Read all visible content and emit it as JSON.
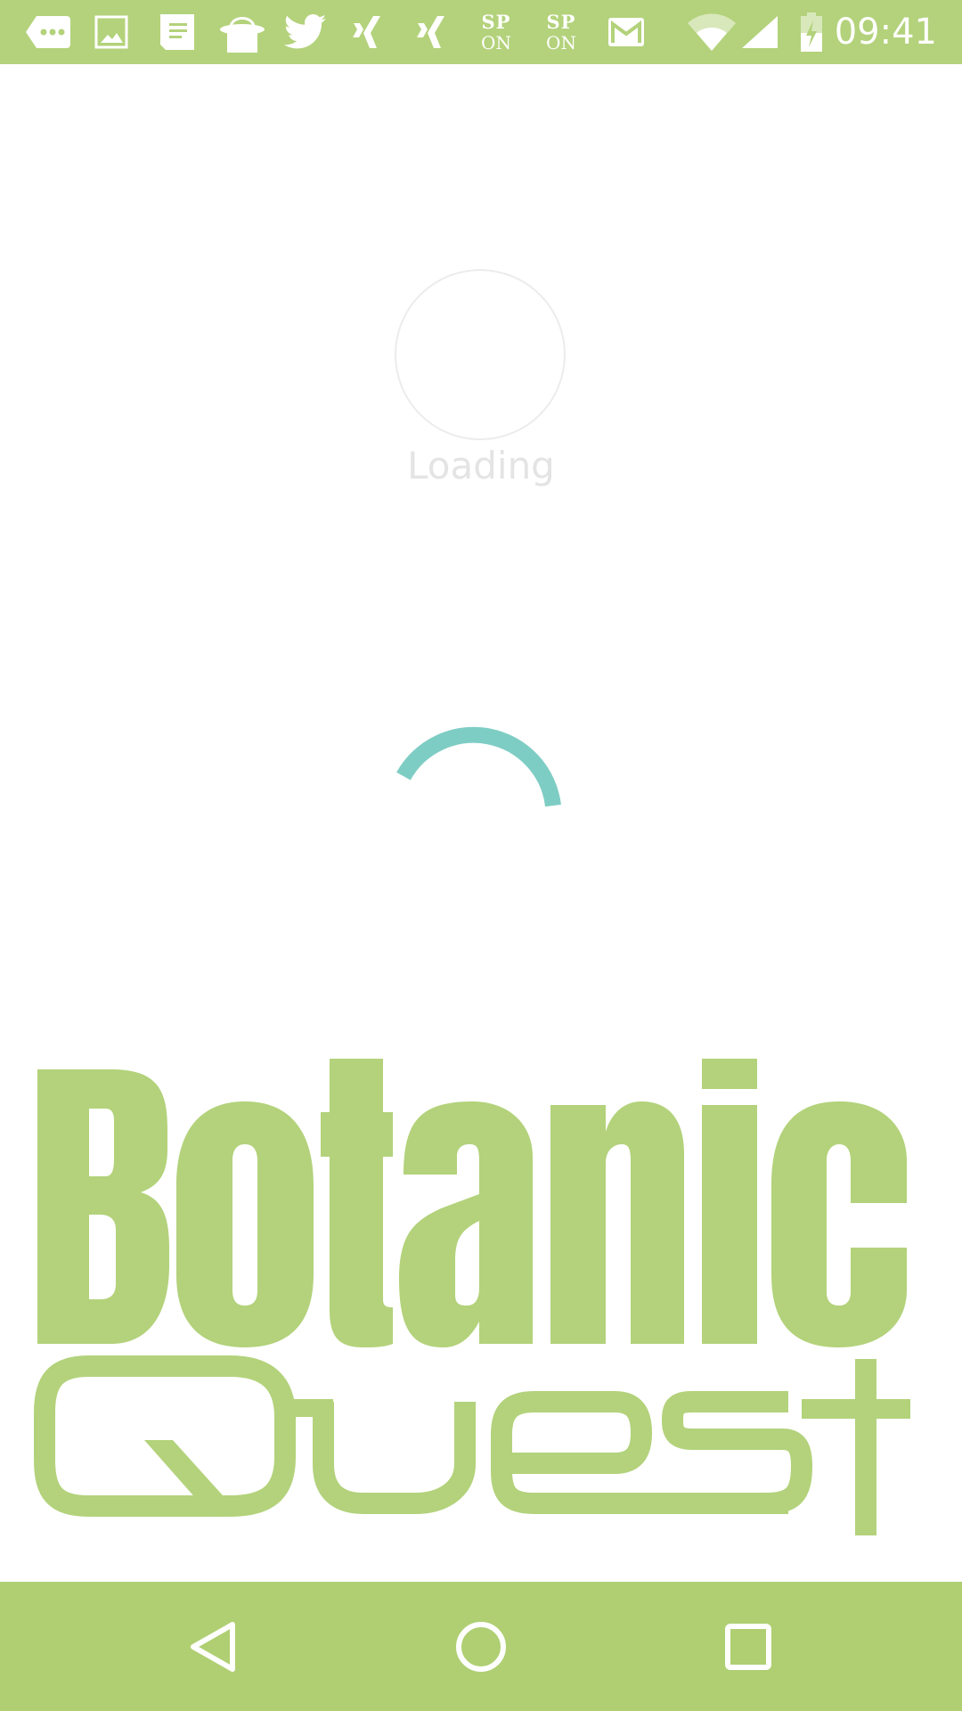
{
  "status_bar": {
    "time": "09:41",
    "notification_icons": [
      "more-options-icon",
      "image-icon",
      "document-icon",
      "shopping-bag-icon",
      "twitter-icon",
      "xing-icon",
      "xing-icon",
      "sp-on-icon",
      "sp-on-icon",
      "gmail-icon"
    ],
    "sp_on_top": "SP",
    "sp_on_bottom": "ON",
    "system_icons": [
      "wifi-icon",
      "cell-signal-icon",
      "battery-charging-icon"
    ]
  },
  "loading": {
    "label": "Loading"
  },
  "logo": {
    "line1": "Botanic",
    "line2": "Quest"
  },
  "navigation_bar": {
    "buttons": [
      "back-icon",
      "home-icon",
      "recents-icon"
    ]
  },
  "colors": {
    "status_bar": "#b3d27b",
    "nav_bar": "#afcf72",
    "logo": "#b3d27b",
    "spinner": "#7ecdc4",
    "loading_text": "#e4e4e4"
  }
}
